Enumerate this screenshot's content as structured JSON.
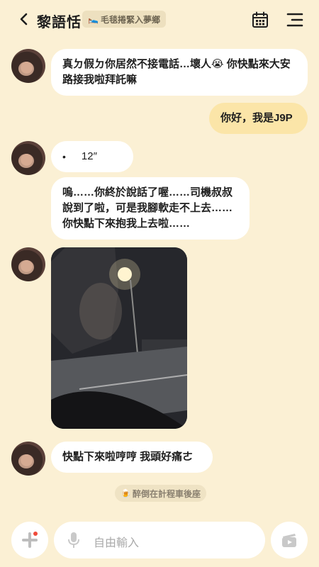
{
  "header": {
    "title": "黎語恬",
    "status_emoji": "🛌",
    "status_text": "毛毯捲緊入夢鄉"
  },
  "messages": [
    {
      "from": "contact",
      "text": "真ㄉ假ㄉ你居然不接電話…壞人😭 你快點來大安路接我啦拜託嘛"
    },
    {
      "from": "me",
      "text": "你好，我是J9P"
    },
    {
      "from": "contact",
      "type": "voice",
      "duration": "12″"
    },
    {
      "from": "contact",
      "text": "嗚……你終於說話了喔……司機叔叔說到了啦，可是我腳軟走不上去……你快點下來抱我上去啦……"
    },
    {
      "from": "contact",
      "type": "photo"
    },
    {
      "from": "contact",
      "text": "快點下來啦哼哼 我頭好痛ㄜ"
    }
  ],
  "system_notice": {
    "emoji": "🍺",
    "text": "醉倒在計程車後座"
  },
  "input": {
    "placeholder": "自由輸入"
  },
  "colors": {
    "background": "#fbf0d4",
    "my_bubble": "#fbe5a8",
    "notify_dot": "#f04a3a"
  }
}
